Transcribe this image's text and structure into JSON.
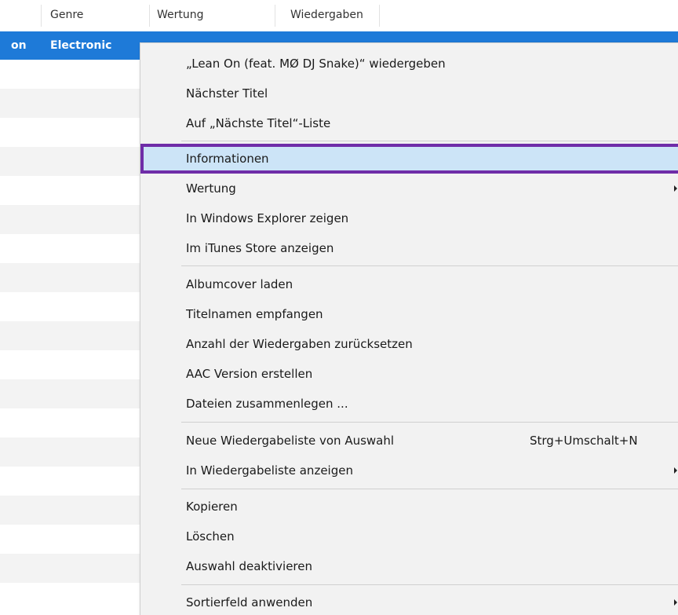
{
  "columns": [
    {
      "label": "Genre"
    },
    {
      "label": "Wertung"
    },
    {
      "label": "Wiedergaben"
    }
  ],
  "selected_row": {
    "name_tail": "on",
    "genre": "Electronic"
  },
  "menu": {
    "groups": [
      [
        {
          "label": "„Lean On (feat. MØ  DJ Snake)“ wiedergeben"
        },
        {
          "label": "Nächster Titel"
        },
        {
          "label": "Auf „Nächste Titel“-Liste"
        }
      ],
      [
        {
          "label": "Informationen",
          "highlighted": true
        },
        {
          "label": "Wertung",
          "submenu": true
        },
        {
          "label": "In Windows Explorer zeigen"
        },
        {
          "label": "Im iTunes Store anzeigen"
        }
      ],
      [
        {
          "label": "Albumcover laden"
        },
        {
          "label": "Titelnamen empfangen"
        },
        {
          "label": "Anzahl der Wiedergaben zurücksetzen"
        },
        {
          "label": "AAC Version erstellen"
        },
        {
          "label": "Dateien zusammenlegen ..."
        }
      ],
      [
        {
          "label": "Neue Wiedergabeliste von Auswahl",
          "shortcut": "Strg+Umschalt+N"
        },
        {
          "label": "In Wiedergabeliste anzeigen",
          "submenu": true
        }
      ],
      [
        {
          "label": "Kopieren"
        },
        {
          "label": "Löschen"
        },
        {
          "label": "Auswahl deaktivieren"
        }
      ],
      [
        {
          "label": "Sortierfeld anwenden",
          "submenu": true
        }
      ]
    ]
  },
  "colors": {
    "selection": "#1e7ad8",
    "menu_hover": "#cce4f7",
    "highlight_outline": "#6f2da8"
  }
}
